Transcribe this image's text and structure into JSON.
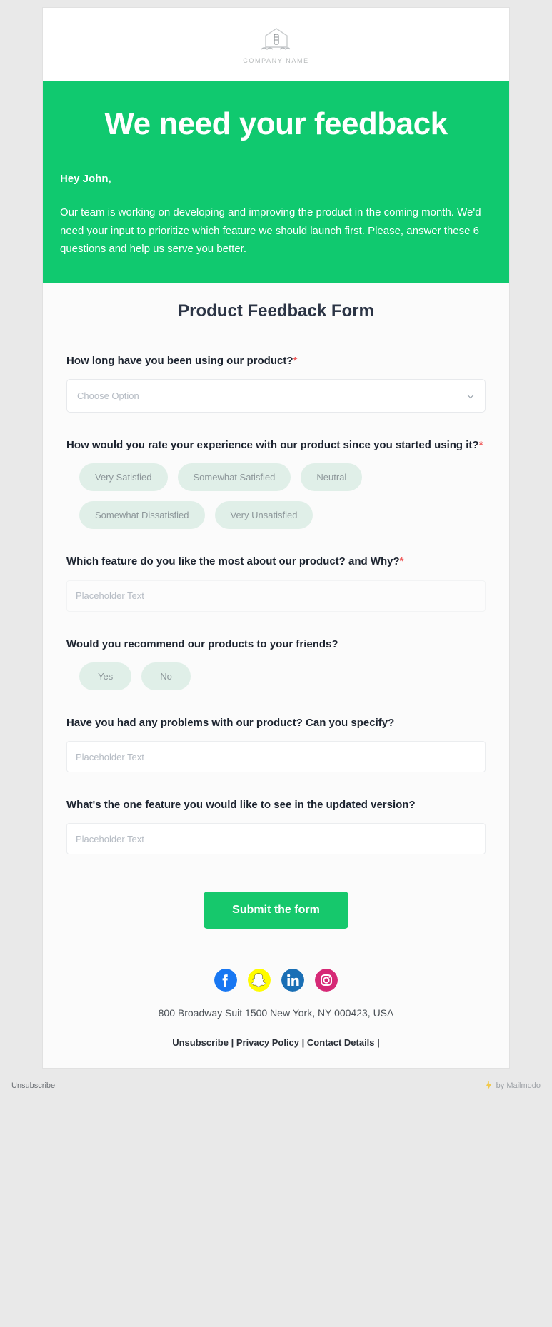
{
  "brand": {
    "logo_icon": "house-logo-icon",
    "company_name": "COMPANY NAME",
    "accent_green": "#10c96f",
    "button_green": "#16c86c",
    "pill_bg": "#e0efe8"
  },
  "hero": {
    "title": "We need your feedback",
    "greeting": "Hey John,",
    "body": "Our team is working on developing and improving the product in the coming month. We'd need your input to prioritize which feature we should launch first. Please, answer these 6 questions and help us serve you better."
  },
  "form": {
    "title": "Product Feedback Form",
    "questions": [
      {
        "label": "How long have you been using our product?",
        "required": "*",
        "type": "select",
        "placeholder": "Choose Option",
        "value": ""
      },
      {
        "label": "How would you rate your experience with our product since you started using it?",
        "required": "*",
        "type": "pills",
        "options": [
          "Very Satisfied",
          "Somewhat Satisfied",
          "Neutral",
          "Somewhat Dissatisfied",
          "Very Unsatisfied"
        ]
      },
      {
        "label": "Which feature do you like the most about our product? and Why?",
        "required": "*",
        "type": "text",
        "placeholder": "Placeholder Text",
        "value": ""
      },
      {
        "label": "Would you recommend our products to your friends?",
        "required": "",
        "type": "pills",
        "options": [
          "Yes",
          "No"
        ]
      },
      {
        "label": "Have you had any problems with our product? Can you specify?",
        "required": "",
        "type": "text",
        "placeholder": "Placeholder Text",
        "value": ""
      },
      {
        "label": "What's the one feature you would like to see in the updated version?",
        "required": "",
        "type": "text",
        "placeholder": "Placeholder Text",
        "value": ""
      }
    ],
    "submit_label": "Submit the form"
  },
  "footer": {
    "social": [
      {
        "name": "facebook-icon",
        "color": "#1877f2"
      },
      {
        "name": "snapchat-icon",
        "color": "#fffc00"
      },
      {
        "name": "linkedin-icon",
        "color": "#1a6fb5"
      },
      {
        "name": "instagram-icon",
        "color": "#d62976"
      }
    ],
    "address": "800 Broadway Suit 1500 New York, NY 000423, USA",
    "links": [
      "Unsubscribe",
      "Privacy Policy",
      "Contact Details"
    ],
    "separator": " | ",
    "trailing_separator": " |"
  },
  "bottom_bar": {
    "unsubscribe": "Unsubscribe",
    "by_brand": "by Mailmodo",
    "brand_icon": "mailmodo-logo-icon"
  }
}
